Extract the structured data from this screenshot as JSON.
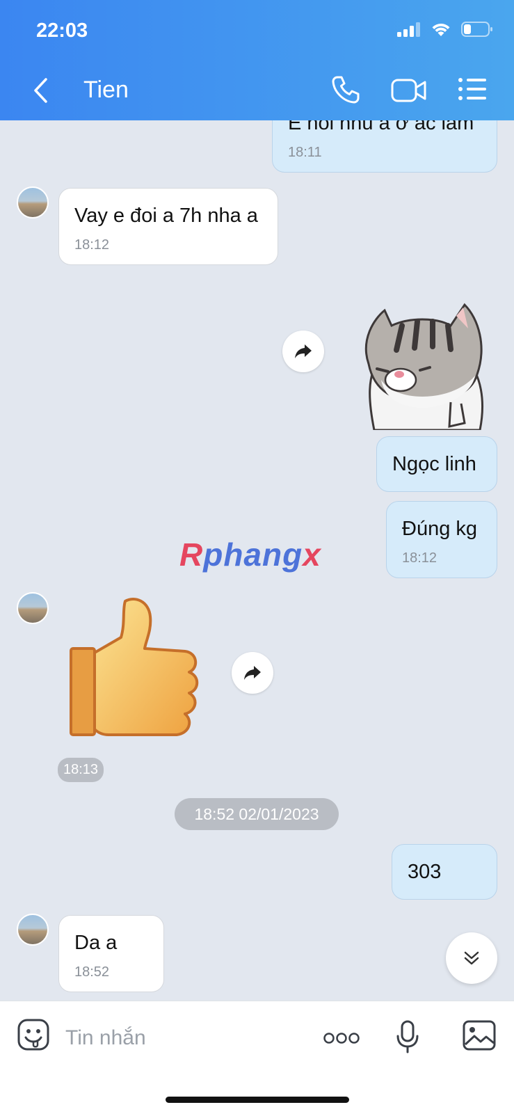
{
  "status_bar": {
    "time": "22:03"
  },
  "header": {
    "title": "Tien"
  },
  "messages": {
    "m1": {
      "text": "E hỏi nhu a ở ác lam",
      "time": "18:11"
    },
    "m2": {
      "text": "Vay e đoi a 7h nha a",
      "time": "18:12"
    },
    "m3": {
      "text": "Ngọc linh"
    },
    "m4": {
      "text": "Đúng kg",
      "time": "18:12"
    },
    "m5": {
      "time": "18:13"
    },
    "date_separator": "18:52 02/01/2023",
    "m6": {
      "text": "303"
    },
    "m7": {
      "text": "Da a",
      "time": "18:52"
    }
  },
  "watermark": {
    "part1": "R",
    "part2": "phang",
    "part3": "x"
  },
  "input": {
    "placeholder": "Tin nhắn"
  },
  "colors": {
    "header_start": "#3b86f1",
    "header_end": "#4aa6ee",
    "outgoing_bubble": "#d6ebfa",
    "incoming_bubble": "#ffffff",
    "chat_bg": "#e2e7ef"
  }
}
